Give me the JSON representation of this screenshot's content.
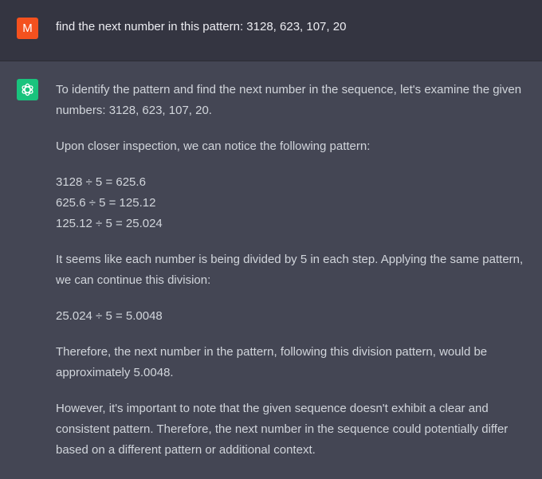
{
  "user": {
    "avatar_letter": "M",
    "avatar_color": "#f4511e",
    "message": "find the next number in this pattern: 3128, 623, 107, 20"
  },
  "assistant": {
    "avatar_icon": "openai-logo-icon",
    "avatar_color": "#19c37d",
    "paragraph_1": "To identify the pattern and find the next number in the sequence, let's examine the given numbers: 3128, 623, 107, 20.",
    "paragraph_2": "Upon closer inspection, we can notice the following pattern:",
    "equations": [
      "3128 ÷ 5 = 625.6",
      "625.6 ÷ 5 = 125.12",
      "125.12 ÷ 5 = 25.024"
    ],
    "paragraph_3": "It seems like each number is being divided by 5 in each step. Applying the same pattern, we can continue this division:",
    "equation_next": "25.024 ÷ 5 = 5.0048",
    "paragraph_4": "Therefore, the next number in the pattern, following this division pattern, would be approximately 5.0048.",
    "paragraph_5": "However, it's important to note that the given sequence doesn't exhibit a clear and consistent pattern. Therefore, the next number in the sequence could potentially differ based on a different pattern or additional context."
  }
}
